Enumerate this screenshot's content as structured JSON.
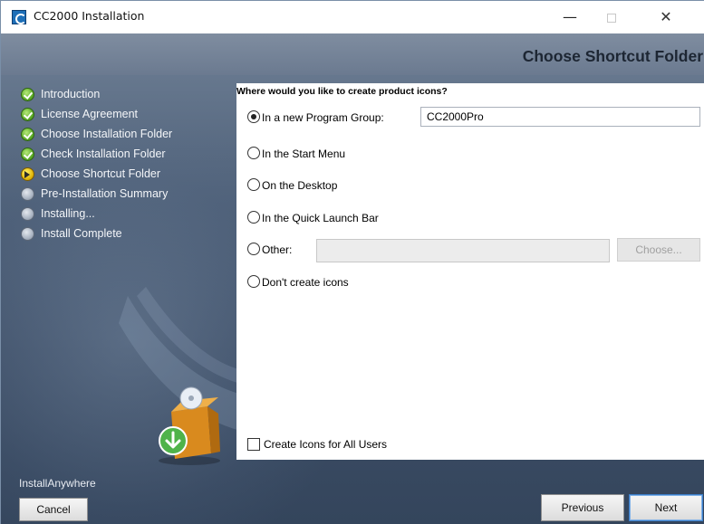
{
  "window": {
    "title": "CC2000 Installation",
    "controls": {
      "minimize": "—",
      "close": "✕"
    }
  },
  "header": {
    "page_heading": "Choose Shortcut Folder"
  },
  "steps": [
    {
      "label": "Introduction",
      "state": "done"
    },
    {
      "label": "License Agreement",
      "state": "done"
    },
    {
      "label": "Choose Installation Folder",
      "state": "done"
    },
    {
      "label": "Check Installation Folder",
      "state": "done"
    },
    {
      "label": "Choose Shortcut Folder",
      "state": "current"
    },
    {
      "label": "Pre-Installation Summary",
      "state": "pending"
    },
    {
      "label": "Installing...",
      "state": "pending"
    },
    {
      "label": "Install Complete",
      "state": "pending"
    }
  ],
  "brand": "InstallAnywhere",
  "panel": {
    "question": "Where would you like to create product icons?",
    "options": {
      "new_group": {
        "label": "In a new Program Group:",
        "value": "CC2000Pro",
        "selected": true
      },
      "start_menu": {
        "label": "In the Start Menu",
        "selected": false
      },
      "desktop": {
        "label": "On the Desktop",
        "selected": false
      },
      "quick_launch": {
        "label": "In the Quick Launch Bar",
        "selected": false
      },
      "other": {
        "label": "Other:",
        "value": "",
        "selected": false
      },
      "none": {
        "label": "Don't create icons",
        "selected": false
      }
    },
    "choose_label": "Choose...",
    "all_users": {
      "label": "Create Icons for All Users",
      "checked": false
    }
  },
  "buttons": {
    "cancel": "Cancel",
    "previous": "Previous",
    "next": "Next"
  },
  "colors": {
    "step_done": "#5fae2a",
    "step_current": "#e3b90d",
    "step_pending": "#aab4c2",
    "background": "#4e6078",
    "next_focus": "#3b7dc8"
  }
}
